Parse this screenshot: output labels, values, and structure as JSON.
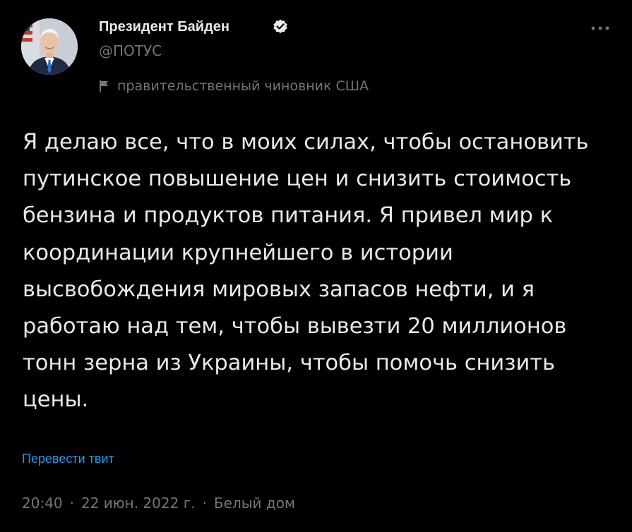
{
  "author": {
    "name": "Президент Байден",
    "handle": "@ПОТУС",
    "verified_icon": "verified-badge-icon",
    "avatar": "avatar-photo"
  },
  "label": {
    "icon": "flag-icon",
    "text": "правительственный чиновник США"
  },
  "menu": {
    "icon": "more-options-icon"
  },
  "tweet": {
    "text": "Я делаю все, что в моих силах, чтобы остановить путинское повышение цен и снизить стоимость бензина и продуктов питания. Я привел мир к координации крупнейшего в истории высвобождения мировых запасов нефти, и я работаю над тем, чтобы вывезти 20 миллионов тонн зерна из Украины, чтобы помочь снизить цены.",
    "translate_label": "Перевести твит"
  },
  "meta": {
    "time": "20:40",
    "date": "22 июн. 2022 г.",
    "source": "Белый дом",
    "separator": "·"
  },
  "colors": {
    "background": "#000000",
    "text": "#e7e9ea",
    "secondary": "#71767b",
    "link": "#1d9bf0"
  }
}
